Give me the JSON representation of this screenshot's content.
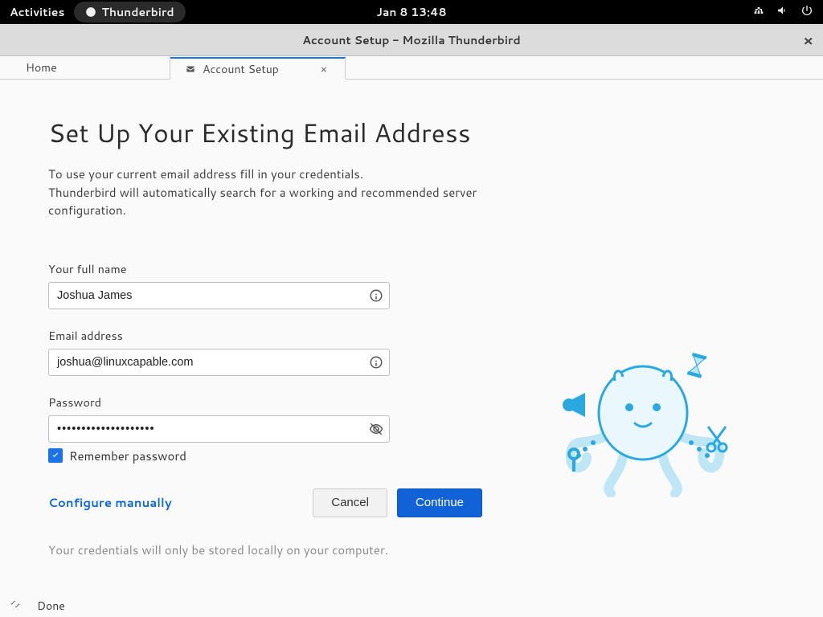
{
  "topbar": {
    "activities": "Activities",
    "app_name": "Thunderbird",
    "clock": "Jan 8  13:48"
  },
  "window": {
    "title": "Account Setup - Mozilla Thunderbird"
  },
  "tabs": {
    "home": "Home",
    "setup": "Account Setup"
  },
  "page": {
    "heading": "Set Up Your Existing Email Address",
    "intro1": "To use your current email address fill in your credentials.",
    "intro2": "Thunderbird will automatically search for a working and recommended server configuration."
  },
  "form": {
    "name_label": "Your full name",
    "name_value": "Joshua James",
    "email_label": "Email address",
    "email_value": "joshua@linuxcapable.com",
    "password_label": "Password",
    "password_value": "••••••••••••••••••••",
    "remember": "Remember password",
    "configure": "Configure manually",
    "cancel": "Cancel",
    "continue": "Continue",
    "note": "Your credentials will only be stored locally on your computer."
  },
  "statusbar": {
    "done": "Done"
  }
}
